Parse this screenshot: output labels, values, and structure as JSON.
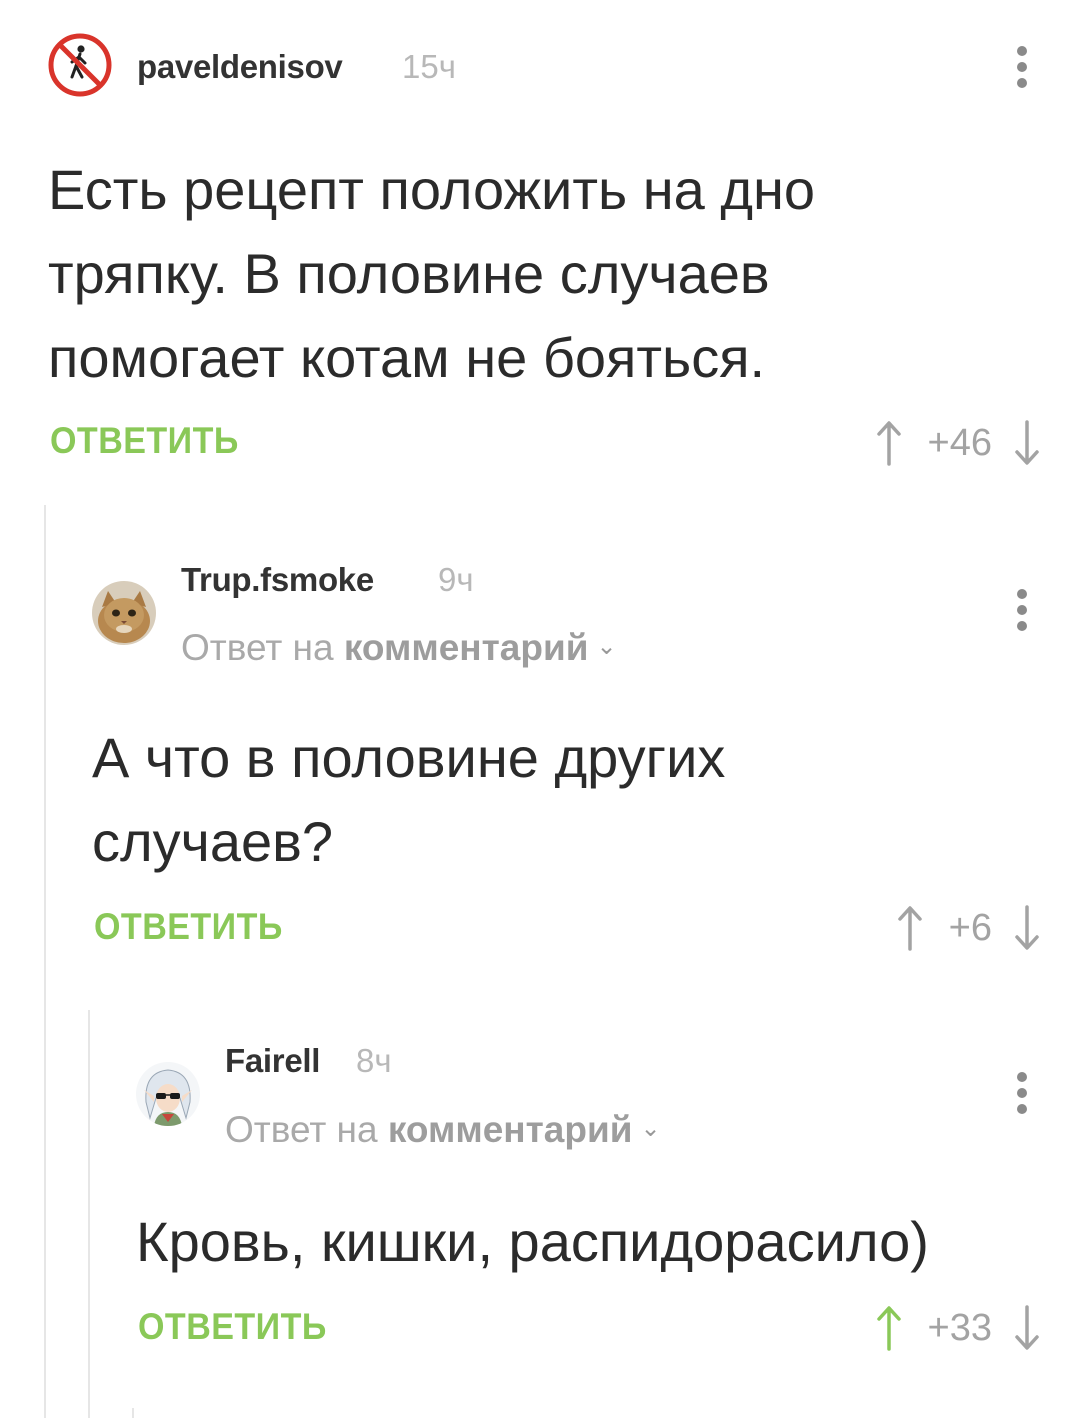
{
  "comments": [
    {
      "username": "paveldenisov",
      "time": "15ч",
      "reply_to_prefix": "",
      "reply_to_target": "",
      "text_lines": [
        "Есть рецепт положить на дно",
        "тряпку. В половине случаев",
        "помогает котам не бояться."
      ],
      "reply_label": "ОТВЕТИТЬ",
      "rating": "+46",
      "upvoted": false,
      "avatar_icon": "no-pedestrian-icon"
    },
    {
      "username": "Trup.fsmoke",
      "time": "9ч",
      "reply_to_prefix": "Ответ на ",
      "reply_to_target": "комментарий",
      "text_lines": [
        "А что в половине других",
        "случаев?"
      ],
      "reply_label": "ОТВЕТИТЬ",
      "rating": "+6",
      "upvoted": false,
      "avatar_icon": "cat-photo"
    },
    {
      "username": "Fairell",
      "time": "8ч",
      "reply_to_prefix": "Ответ на ",
      "reply_to_target": "комментарий",
      "text_lines": [
        "Кровь, кишки, распидорасило)"
      ],
      "reply_label": "ОТВЕТИТЬ",
      "rating": "+33",
      "upvoted": true,
      "avatar_icon": "anime-character"
    }
  ],
  "colors": {
    "reply_green": "#8ac858",
    "upvote_active": "#8ac858",
    "vote_inactive": "#a3a3a3",
    "text": "#2b2b2b",
    "muted": "#b8b8b8"
  }
}
